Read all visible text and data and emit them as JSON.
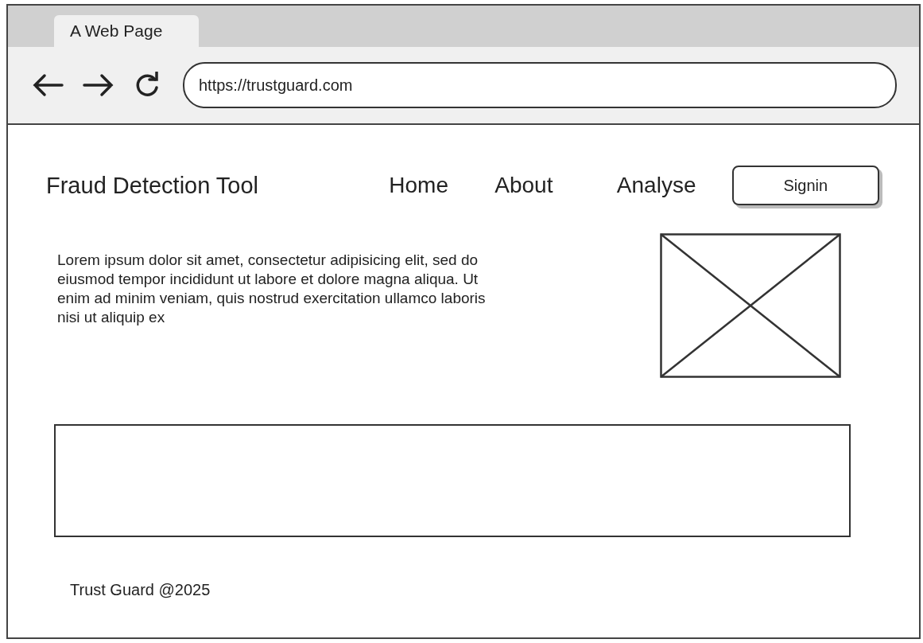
{
  "browser": {
    "tab_title": "A Web Page",
    "url": "https://trustguard.com"
  },
  "header": {
    "site_title": "Fraud Detection Tool",
    "nav": [
      "Home",
      "About",
      "Analyse"
    ],
    "signin_button": "Signin"
  },
  "intro": {
    "paragraph": "Lorem ipsum dolor sit amet, consectetur adipisicing elit, sed do eiusmod tempor incididunt ut labore et dolore magna aliqua. Ut enim ad minim veniam, quis nostrud exercitation ullamco laboris nisi ut aliquip ex"
  },
  "footer": {
    "text": "Trust Guard @2025"
  }
}
